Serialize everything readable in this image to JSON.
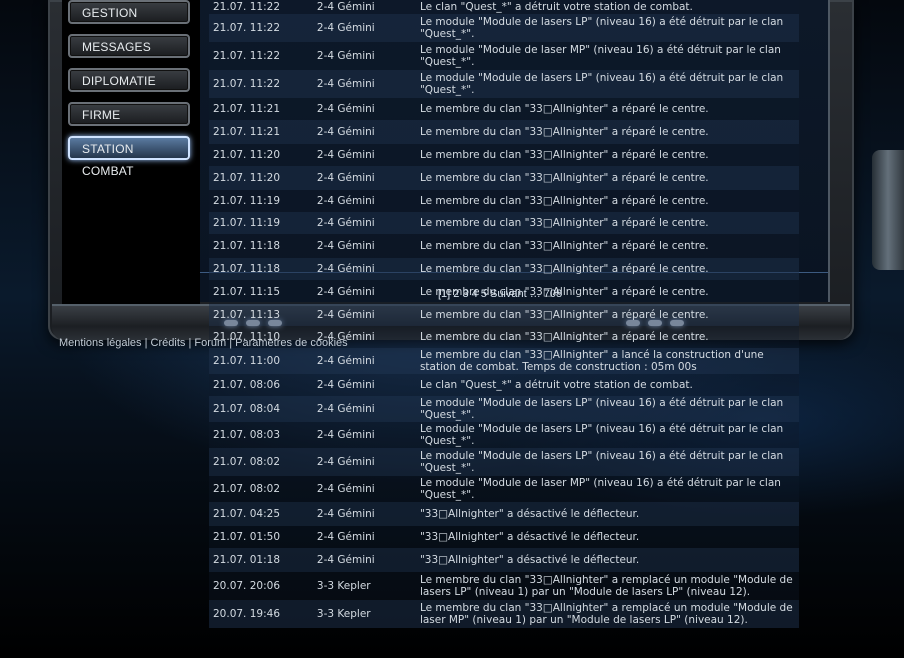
{
  "menu": [
    {
      "label": "GESTION",
      "active": false
    },
    {
      "label": "MESSAGES",
      "active": false
    },
    {
      "label": "DIPLOMATIE",
      "active": false
    },
    {
      "label": "FIRME",
      "active": false
    },
    {
      "label": "STATION COMBAT",
      "active": true
    }
  ],
  "pagination": {
    "text": "[1] 2 3 4 5 Suivant … 708"
  },
  "footer": {
    "mentions": "Mentions légales",
    "credits": "Crédits",
    "forum": "Forum",
    "cookies": "Paramètres de cookies",
    "separator": "|"
  },
  "log": [
    {
      "date": "21.07. 11:22",
      "sector": "2-4 Gémini",
      "message": "Le clan \"Quest_*\" a détruit votre station de combat."
    },
    {
      "date": "21.07. 11:22",
      "sector": "2-4 Gémini",
      "message": "Le module \"Module de lasers LP\" (niveau 16) a été détruit par le clan \"Quest_*\"."
    },
    {
      "date": "21.07. 11:22",
      "sector": "2-4 Gémini",
      "message": "Le module \"Module de laser MP\" (niveau 16) a été détruit par le clan \"Quest_*\"."
    },
    {
      "date": "21.07. 11:22",
      "sector": "2-4 Gémini",
      "message": "Le module \"Module de lasers LP\" (niveau 16) a été détruit par le clan \"Quest_*\"."
    },
    {
      "date": "21.07. 11:21",
      "sector": "2-4 Gémini",
      "message": "Le membre du clan \"33□Allnighter\" a réparé le centre."
    },
    {
      "date": "21.07. 11:21",
      "sector": "2-4 Gémini",
      "message": "Le membre du clan \"33□Allnighter\" a réparé le centre."
    },
    {
      "date": "21.07. 11:20",
      "sector": "2-4 Gémini",
      "message": "Le membre du clan \"33□Allnighter\" a réparé le centre."
    },
    {
      "date": "21.07. 11:20",
      "sector": "2-4 Gémini",
      "message": "Le membre du clan \"33□Allnighter\" a réparé le centre."
    },
    {
      "date": "21.07. 11:19",
      "sector": "2-4 Gémini",
      "message": "Le membre du clan \"33□Allnighter\" a réparé le centre."
    },
    {
      "date": "21.07. 11:19",
      "sector": "2-4 Gémini",
      "message": "Le membre du clan \"33□Allnighter\" a réparé le centre."
    },
    {
      "date": "21.07. 11:18",
      "sector": "2-4 Gémini",
      "message": "Le membre du clan \"33□Allnighter\" a réparé le centre."
    },
    {
      "date": "21.07. 11:18",
      "sector": "2-4 Gémini",
      "message": "Le membre du clan \"33□Allnighter\" a réparé le centre."
    },
    {
      "date": "21.07. 11:15",
      "sector": "2-4 Gémini",
      "message": "Le membre du clan \"33□Allnighter\" a réparé le centre."
    },
    {
      "date": "21.07. 11:13",
      "sector": "2-4 Gémini",
      "message": "Le membre du clan \"33□Allnighter\" a réparé le centre."
    },
    {
      "date": "21.07. 11:10",
      "sector": "2-4 Gémini",
      "message": "Le membre du clan \"33□Allnighter\" a réparé le centre."
    },
    {
      "date": "21.07. 11:00",
      "sector": "2-4 Gémini",
      "message": "Le membre du clan \"33□Allnighter\" a lancé la construction d'une station de combat. Temps de construction : 05m 00s"
    },
    {
      "date": "21.07. 08:06",
      "sector": "2-4 Gémini",
      "message": "Le clan \"Quest_*\" a détruit votre station de combat."
    },
    {
      "date": "21.07. 08:04",
      "sector": "2-4 Gémini",
      "message": "Le module \"Module de lasers LP\" (niveau 16) a été détruit par le clan \"Quest_*\"."
    },
    {
      "date": "21.07. 08:03",
      "sector": "2-4 Gémini",
      "message": "Le module \"Module de lasers LP\" (niveau 16) a été détruit par le clan \"Quest_*\"."
    },
    {
      "date": "21.07. 08:02",
      "sector": "2-4 Gémini",
      "message": "Le module \"Module de lasers LP\" (niveau 16) a été détruit par le clan \"Quest_*\"."
    },
    {
      "date": "21.07. 08:02",
      "sector": "2-4 Gémini",
      "message": "Le module \"Module de laser MP\" (niveau 16) a été détruit par le clan \"Quest_*\"."
    },
    {
      "date": "21.07. 04:25",
      "sector": "2-4 Gémini",
      "message": "\"33□Allnighter\" a désactivé le déflecteur."
    },
    {
      "date": "21.07. 01:50",
      "sector": "2-4 Gémini",
      "message": "\"33□Allnighter\" a désactivé le déflecteur."
    },
    {
      "date": "21.07. 01:18",
      "sector": "2-4 Gémini",
      "message": "\"33□Allnighter\" a désactivé le déflecteur."
    },
    {
      "date": "20.07. 20:06",
      "sector": "3-3 Kepler",
      "message": "Le membre du clan \"33□Allnighter\" a remplacé un module \"Module de lasers LP\" (niveau 1) par un \"Module de lasers LP\" (niveau 12)."
    },
    {
      "date": "20.07. 19:46",
      "sector": "3-3 Kepler",
      "message": "Le membre du clan \"33□Allnighter\" a remplacé un module \"Module de laser MP\" (niveau 1) par un \"Module de lasers LP\" (niveau 12)."
    }
  ]
}
